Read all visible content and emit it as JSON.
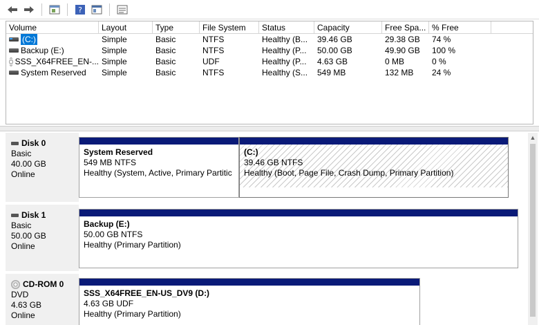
{
  "toolbar": {
    "buttons": [
      "back-icon",
      "forward-icon",
      "properties-icon",
      "help-icon",
      "console-icon",
      "view-icon"
    ]
  },
  "volumes": {
    "headers": [
      "Volume",
      "Layout",
      "Type",
      "File System",
      "Status",
      "Capacity",
      "Free Spa...",
      "% Free"
    ],
    "rows": [
      {
        "name": "(C:)",
        "layout": "Simple",
        "type": "Basic",
        "fs": "NTFS",
        "status": "Healthy (B...",
        "capacity": "39.46 GB",
        "free": "29.38 GB",
        "pct": "74 %"
      },
      {
        "name": "Backup (E:)",
        "layout": "Simple",
        "type": "Basic",
        "fs": "NTFS",
        "status": "Healthy (P...",
        "capacity": "50.00 GB",
        "free": "49.90 GB",
        "pct": "100 %"
      },
      {
        "name": "SSS_X64FREE_EN-...",
        "layout": "Simple",
        "type": "Basic",
        "fs": "UDF",
        "status": "Healthy (P...",
        "capacity": "4.63 GB",
        "free": "0 MB",
        "pct": "0 %"
      },
      {
        "name": "System Reserved",
        "layout": "Simple",
        "type": "Basic",
        "fs": "NTFS",
        "status": "Healthy (S...",
        "capacity": "549 MB",
        "free": "132 MB",
        "pct": "24 %"
      }
    ]
  },
  "disks": [
    {
      "name": "Disk 0",
      "type": "Basic",
      "size": "40.00 GB",
      "state": "Online",
      "partitions": [
        {
          "title": "System Reserved",
          "size": "549 MB NTFS",
          "status": "Healthy (System, Active, Primary Partitic"
        },
        {
          "title": "(C:)",
          "size": "39.46 GB NTFS",
          "status": "Healthy (Boot, Page File, Crash Dump, Primary Partition)"
        }
      ]
    },
    {
      "name": "Disk 1",
      "type": "Basic",
      "size": "50.00 GB",
      "state": "Online",
      "partitions": [
        {
          "title": "Backup  (E:)",
          "size": "50.00 GB NTFS",
          "status": "Healthy (Primary Partition)"
        }
      ]
    },
    {
      "name": "CD-ROM 0",
      "type": "DVD",
      "size": "4.63 GB",
      "state": "Online",
      "partitions": [
        {
          "title": "SSS_X64FREE_EN-US_DV9  (D:)",
          "size": "4.63 GB UDF",
          "status": "Healthy (Primary Partition)"
        }
      ]
    }
  ],
  "colors": {
    "partition_bar": "#0a1a78",
    "selection": "#0078d7"
  }
}
